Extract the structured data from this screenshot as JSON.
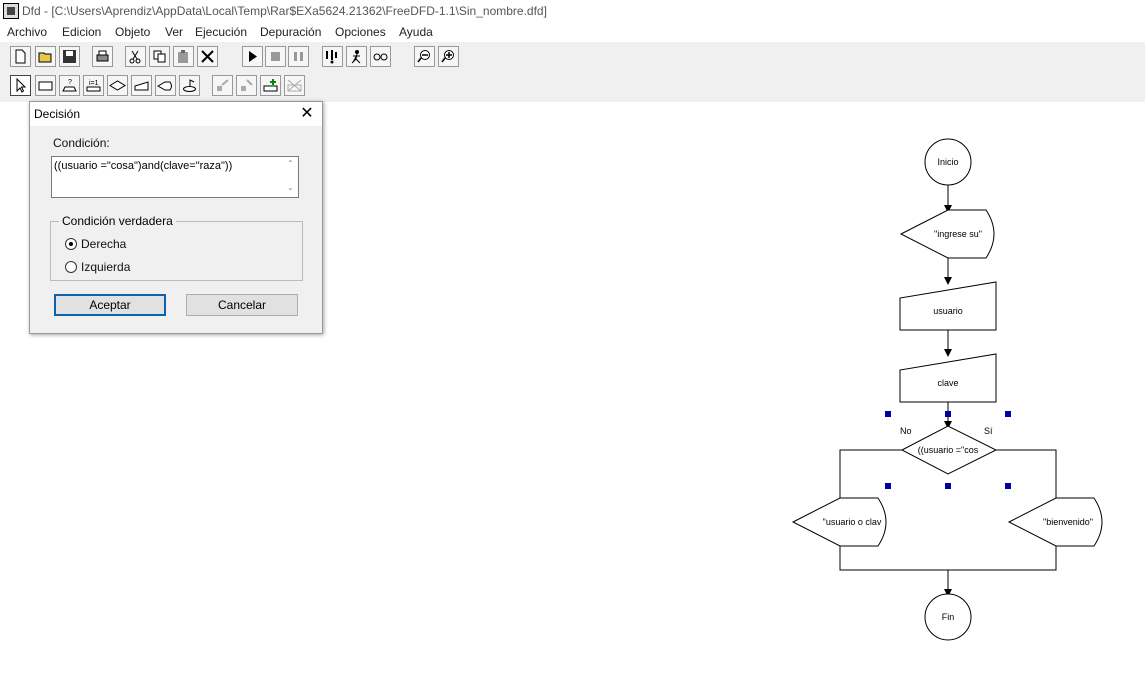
{
  "window": {
    "title": "Dfd - [C:\\Users\\Aprendiz\\AppData\\Local\\Temp\\Rar$EXa5624.21362\\FreeDFD-1.1\\Sin_nombre.dfd]"
  },
  "menu": [
    "Archivo",
    "Edicion",
    "Objeto",
    "Ver",
    "Ejecución",
    "Depuración",
    "Opciones",
    "Ayuda"
  ],
  "toolbar": {
    "row1": [
      "new-file-icon",
      "open-folder-icon",
      "save-disk-icon",
      "print-icon",
      "cut-icon",
      "copy-icon",
      "paste-icon",
      "delete-icon",
      "run-icon",
      "stop-icon",
      "pause-icon",
      "step-icon",
      "debug-run-icon",
      "watch-icon",
      "zoom-out-icon",
      "zoom-in-icon"
    ],
    "row2": [
      "pointer-icon",
      "assignment-icon",
      "read-icon",
      "for-loop-icon",
      "decision-icon",
      "input-icon",
      "output-icon",
      "while-loop-icon",
      "disabled-tool-1-icon",
      "disabled-tool-2-icon",
      "insert-icon",
      "disabled-delete-icon"
    ]
  },
  "dialog": {
    "title": "Decisión",
    "close_glyph": "✕",
    "condition_label": "Condición:",
    "condition_value": "((usuario =\"cosa\")and(clave=\"raza\"))",
    "group_title": "Condición verdadera",
    "options": [
      {
        "label": "Derecha",
        "selected": true
      },
      {
        "label": "Izquierda",
        "selected": false
      }
    ],
    "accept_label": "Aceptar",
    "cancel_label": "Cancelar"
  },
  "flowchart": {
    "start": "Inicio",
    "prompt": "\"ingrese su\"",
    "read_1": "usuario",
    "read_2": "clave",
    "decision": "((usuario =\"cos",
    "no_label": "No",
    "yes_label": "Sí",
    "output_no": "\"usuario o clav",
    "output_yes": "\"bienvenido\"",
    "end": "Fin"
  },
  "colors": {
    "toolbar_bg": "#f0f0f0",
    "selection_handle": "#0000a0",
    "default_button_border": "#0a64ad"
  }
}
